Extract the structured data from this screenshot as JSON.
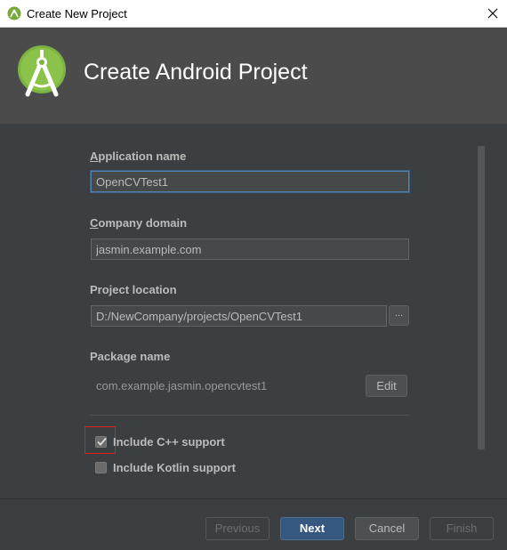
{
  "window": {
    "title": "Create New Project",
    "app_icon": "android-studio-icon",
    "close_icon": "close-icon"
  },
  "header": {
    "logo_icon": "android-studio-logo",
    "heading": "Create Android Project"
  },
  "form": {
    "application_name": {
      "label_accel": "A",
      "label_rest": "pplication name",
      "value": "OpenCVTest1"
    },
    "company_domain": {
      "label_accel": "C",
      "label_rest": "ompany domain",
      "value": "jasmin.example.com"
    },
    "project_location": {
      "label": "Project location",
      "value": "D:/NewCompany/projects/OpenCVTest1",
      "browse_label": "..."
    },
    "package_name": {
      "label": "Package name",
      "value": "com.example.jasmin.opencvtest1",
      "edit_label": "Edit"
    },
    "options": [
      {
        "label": "Include C++ support",
        "checked": true
      },
      {
        "label": "Include Kotlin support",
        "checked": false
      }
    ]
  },
  "footer": {
    "previous_label": "Previous",
    "next_label": "Next",
    "cancel_label": "Cancel",
    "finish_label": "Finish"
  },
  "colors": {
    "background": "#3c3f41",
    "banner": "#4b4b4b",
    "accent_primary": "#365880",
    "highlight": "#e02020",
    "android_green": "#7cb342"
  }
}
